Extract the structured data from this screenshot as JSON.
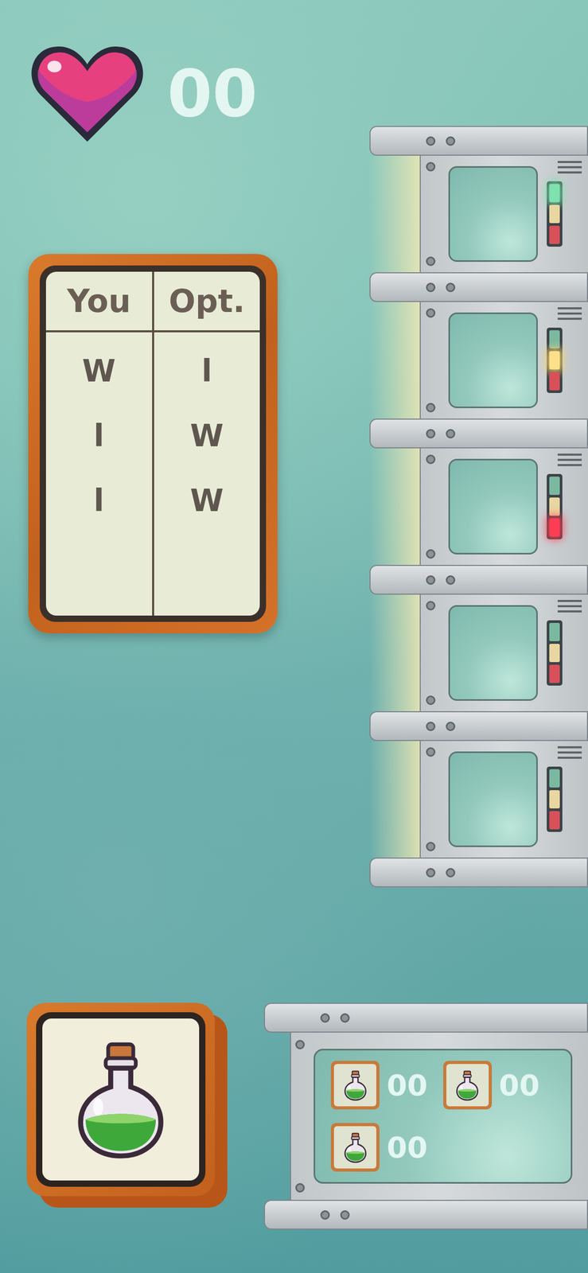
{
  "lives": {
    "count": "00"
  },
  "scoreboard": {
    "columns": [
      "You",
      "Opt."
    ],
    "rows": [
      {
        "you": "W",
        "opt": "l"
      },
      {
        "you": "l",
        "opt": "W"
      },
      {
        "you": "l",
        "opt": "W"
      }
    ]
  },
  "machines": [
    {
      "light": "green"
    },
    {
      "light": "yellow"
    },
    {
      "light": "red"
    },
    {
      "light": "none"
    },
    {
      "light": "none"
    }
  ],
  "inventory": [
    {
      "count": "00"
    },
    {
      "count": "00"
    },
    {
      "count": "00"
    }
  ]
}
